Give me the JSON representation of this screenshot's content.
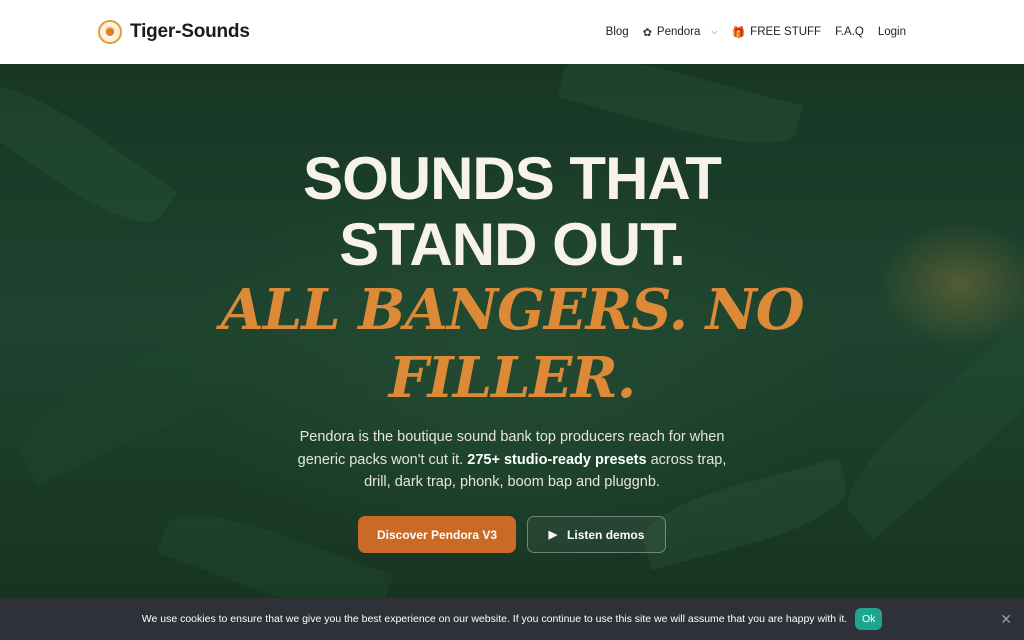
{
  "header": {
    "brand": "Tiger-Sounds",
    "nav": [
      {
        "label": "Blog",
        "icon": ""
      },
      {
        "label": "Pendora",
        "icon": "leaf-icon",
        "has_dropdown": true
      },
      {
        "label": "FREE STUFF",
        "icon": "gift-icon"
      },
      {
        "label": "F.A.Q",
        "icon": ""
      },
      {
        "label": "Login",
        "icon": ""
      }
    ]
  },
  "hero": {
    "headline_line1": "SOUNDS THAT",
    "headline_line2": "STAND OUT.",
    "accent_line1": "ALL BANGERS. NO",
    "accent_line2": "FILLER.",
    "desc_part1": "Pendora is the boutique sound bank top producers reach for when generic packs won't cut it.",
    "desc_strong": "275+ studio-ready presets",
    "desc_part2": "across trap, drill, dark trap, phonk, boom bap and pluggnb.",
    "cta_primary": "Discover Pendora V3",
    "cta_secondary": "Listen demos"
  },
  "cookie": {
    "text": "We use cookies to ensure that we give you the best experience on our website. If you continue to use this site we will assume that you are happy with it.",
    "ok": "Ok"
  },
  "colors": {
    "accent": "#c96a27",
    "accent_text": "#dc8a38",
    "hero_bg": "#1e4430",
    "cookie_bg": "#2f3138",
    "ok_button": "#1fa58f"
  }
}
